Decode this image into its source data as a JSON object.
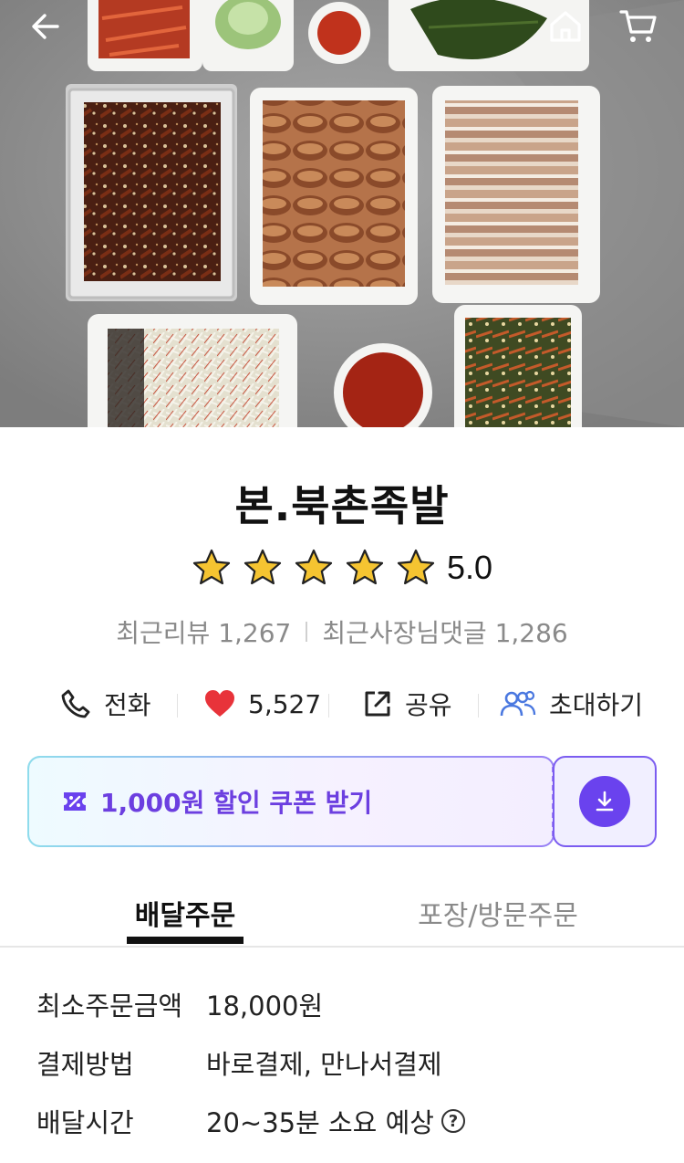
{
  "header": {
    "back_icon": "arrow-left-icon",
    "home_icon": "home-icon",
    "cart_icon": "cart-icon"
  },
  "store": {
    "name": "본.북촌족발",
    "rating": "5.0",
    "rating_stars": 5,
    "recent_reviews": "최근리뷰 1,267",
    "owner_replies": "최근사장님댓글 1,286"
  },
  "actions": {
    "call_label": "전화",
    "like_count": "5,527",
    "share_label": "공유",
    "invite_label": "초대하기"
  },
  "coupon": {
    "text": "1,000원 할인 쿠폰 받기"
  },
  "tabs": {
    "delivery": "배달주문",
    "pickup": "포장/방문주문"
  },
  "info": {
    "min_order_label": "최소주문금액",
    "min_order_value": "18,000원",
    "payment_label": "결제방법",
    "payment_value": "바로결제, 만나서결제",
    "delivery_time_label": "배달시간",
    "delivery_time_value": "20~35분 소요 예상"
  },
  "colors": {
    "accent": "#6a42ee",
    "heart": "#e8333a",
    "star": "#f5c431",
    "muted": "#8a8a8a",
    "invite_icon": "#4a78e0"
  }
}
